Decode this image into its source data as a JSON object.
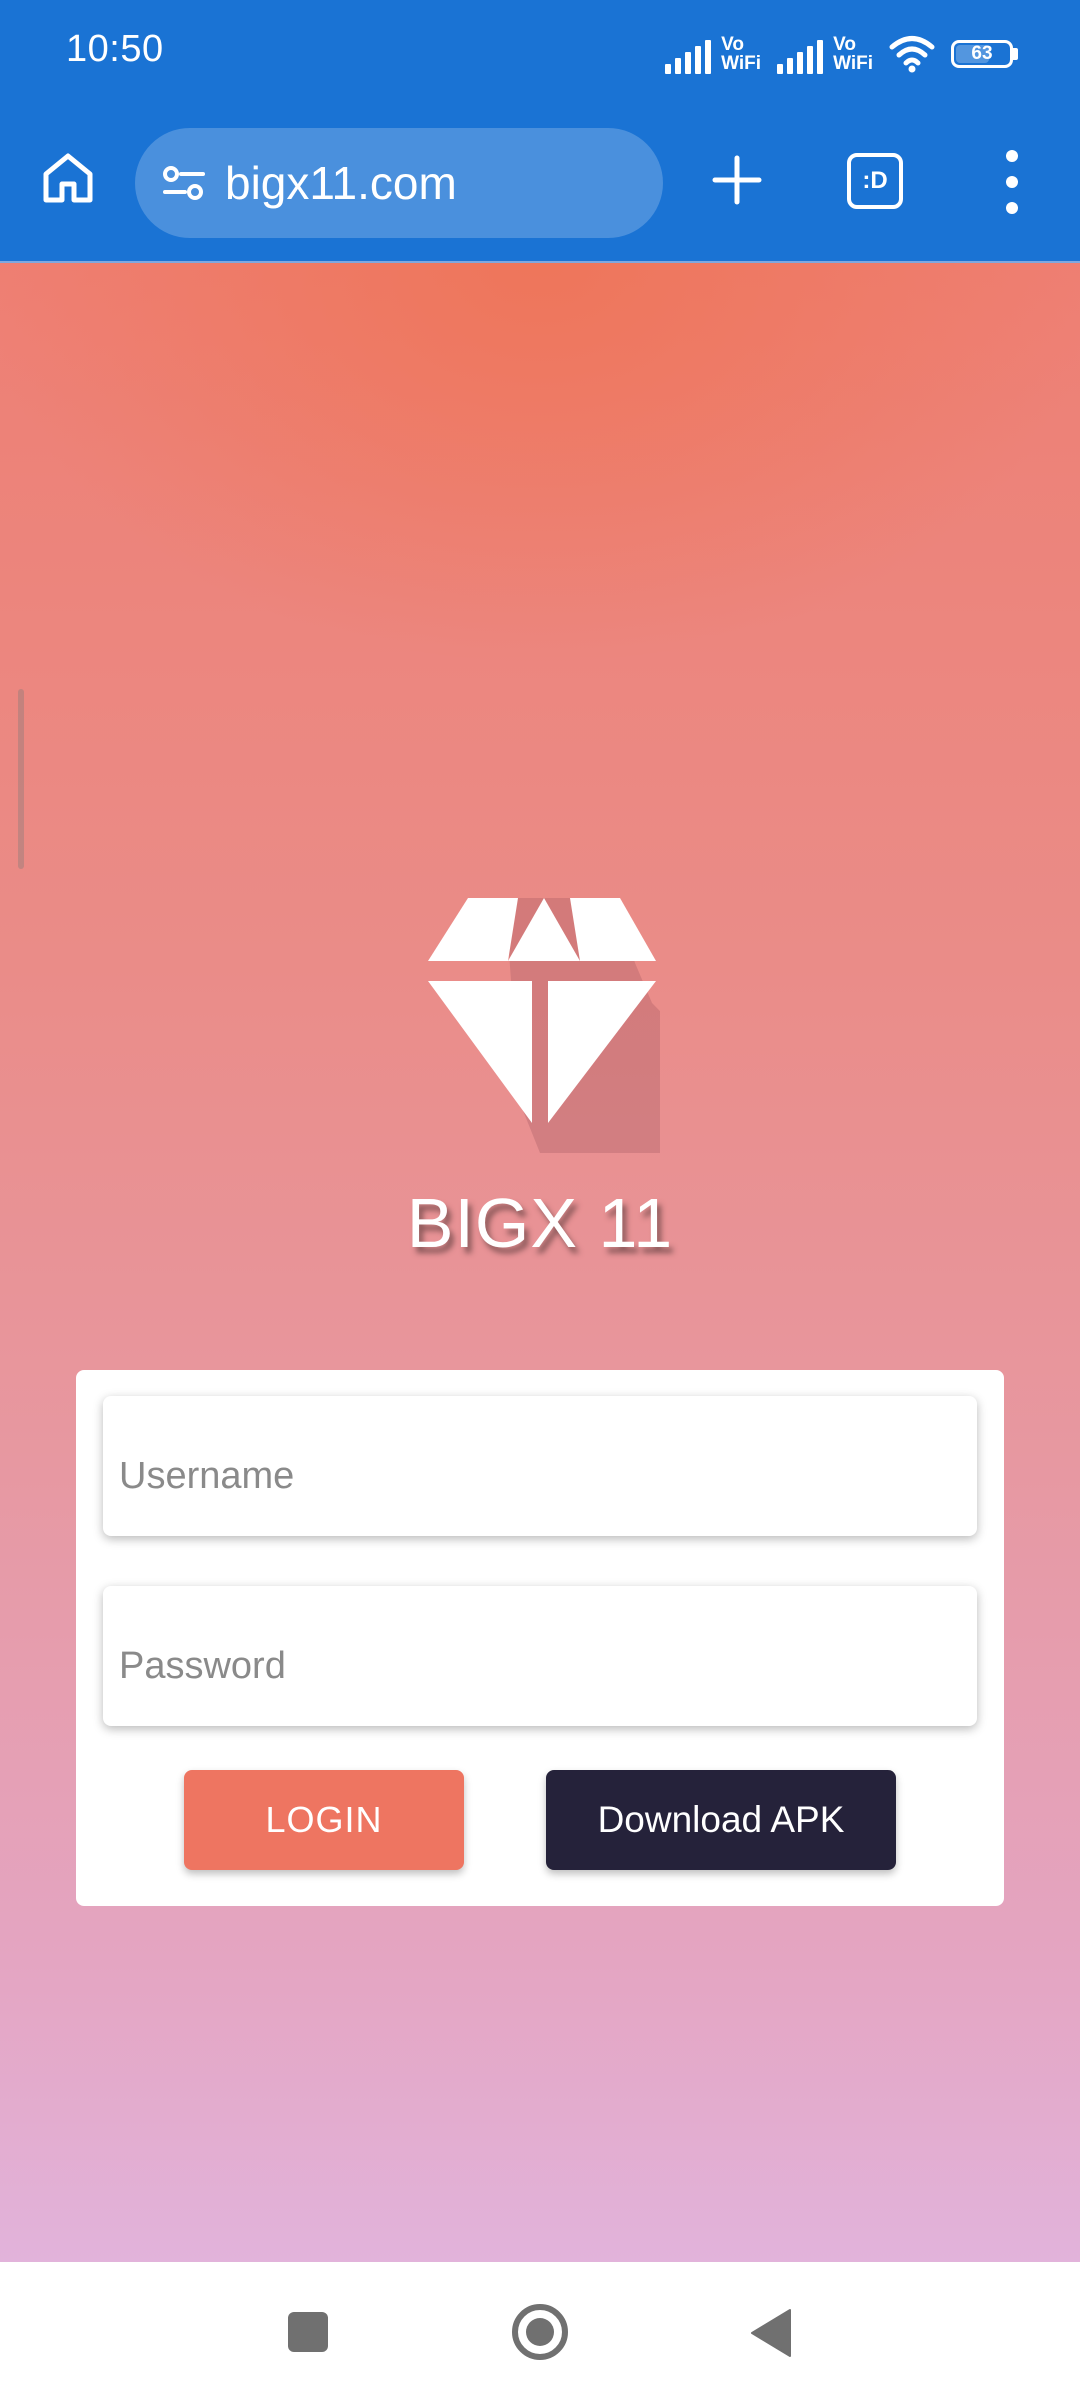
{
  "status_bar": {
    "time": "10:50",
    "vowifi_1": [
      "Vo",
      "WiFi"
    ],
    "vowifi_2": [
      "Vo",
      "WiFi"
    ],
    "battery": "63",
    "battery_level": 0.63
  },
  "browser": {
    "url": "bigx11.com",
    "tabs_label": ":D",
    "icons": {
      "home": "home-icon",
      "site_settings": "tune-icon",
      "new_tab": "plus-icon",
      "tabs": "tab-switcher-icon",
      "menu": "more-vert-icon"
    }
  },
  "page": {
    "brand_name": "BIGX 11",
    "logo": "diamond-logo",
    "colors": {
      "login_button": "#ee7561",
      "apk_button": "#25223a",
      "browser_chrome": "#1a73d4"
    },
    "form": {
      "username_placeholder": "Username",
      "password_placeholder": "Password",
      "login_label": "LOGIN",
      "download_label": "Download APK"
    }
  },
  "nav_bar": {
    "icons": [
      "recents-icon",
      "home-circle-icon",
      "back-icon"
    ]
  }
}
